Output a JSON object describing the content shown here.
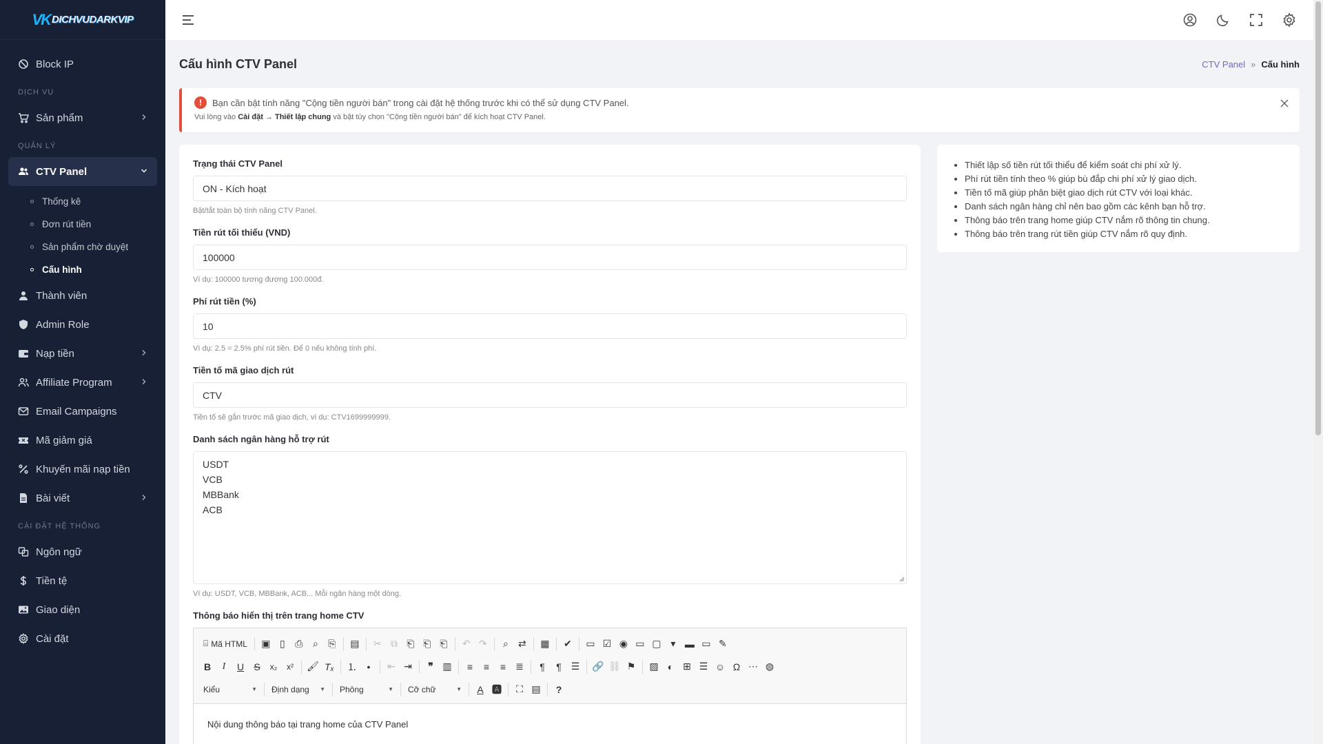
{
  "brand": {
    "logo_mark": "VK",
    "logo_text": "DICHVUDARKVIP"
  },
  "sidebar": {
    "block_ip": "Block IP",
    "section_service": "DỊCH VỤ",
    "products": "Sản phẩm",
    "section_manage": "QUẢN LÝ",
    "ctv_panel": "CTV Panel",
    "ctv_sub": [
      "Thống kê",
      "Đơn rút tiền",
      "Sản phẩm chờ duyệt",
      "Cấu hình"
    ],
    "members": "Thành viên",
    "admin_role": "Admin Role",
    "topup": "Nạp tiền",
    "affiliate": "Affiliate Program",
    "email_campaigns": "Email Campaigns",
    "coupons": "Mã giảm giá",
    "topup_promo": "Khuyến mãi nạp tiền",
    "posts": "Bài viết",
    "section_system": "CÀI ĐẶT HỆ THỐNG",
    "language": "Ngôn ngữ",
    "currency": "Tiền tệ",
    "theme": "Giao diện",
    "settings": "Cài đặt"
  },
  "header": {
    "icons": [
      "menu-icon",
      "user-circle-icon",
      "moon-icon",
      "fullscreen-icon",
      "gear-icon"
    ]
  },
  "page": {
    "title": "Cấu hình CTV Panel",
    "breadcrumb_parent": "CTV Panel",
    "breadcrumb_sep": "»",
    "breadcrumb_current": "Cấu hình"
  },
  "alert": {
    "message": "Bạn cần bật tính năng \"Cộng tiền người bán\" trong cài đặt hệ thống trước khi có thể sử dụng CTV Panel.",
    "detail_prefix": "Vui lòng vào ",
    "detail_path": "Cài đặt → Thiết lập chung",
    "detail_suffix": " và bật tùy chọn \"Cộng tiền người bán\" để kích hoạt CTV Panel."
  },
  "form": {
    "status_label": "Trạng thái CTV Panel",
    "status_value": "ON - Kích hoạt",
    "status_hint": "Bật/tắt toàn bộ tính năng CTV Panel.",
    "min_label": "Tiền rút tối thiểu (VND)",
    "min_value": "100000",
    "min_hint": "Ví dụ: 100000 tương đương 100.000đ.",
    "fee_label": "Phí rút tiền (%)",
    "fee_value": "10",
    "fee_hint": "Ví dụ: 2.5 = 2.5% phí rút tiền. Để 0 nếu không tính phí.",
    "prefix_label": "Tiền tố mã giao dịch rút",
    "prefix_value": "CTV",
    "prefix_hint": "Tiền tố sẽ gắn trước mã giao dịch, ví dụ: CTV1699999999.",
    "banks_label": "Danh sách ngân hàng hỗ trợ rút",
    "banks": [
      "USDT",
      "VCB",
      "MBBank",
      "ACB"
    ],
    "banks_hint": "Ví dụ: USDT, VCB, MBBank, ACB... Mỗi ngân hàng một dòng.",
    "notice_label": "Thông báo hiển thị trên trang home CTV"
  },
  "editor": {
    "source_label": "Mã HTML",
    "combo_style": "Kiểu",
    "combo_format": "Định dạng",
    "combo_font": "Phông",
    "combo_size": "Cỡ chữ",
    "body": "Nội dung thông báo tại trang home của CTV Panel"
  },
  "tips": [
    "Thiết lập số tiền rút tối thiểu để kiểm soát chi phí xử lý.",
    "Phí rút tiền tính theo % giúp bù đắp chi phí xử lý giao dịch.",
    "Tiền tố mã giúp phân biệt giao dịch rút CTV với loại khác.",
    "Danh sách ngân hàng chỉ nên bao gồm các kênh bạn hỗ trợ.",
    "Thông báo trên trang home giúp CTV nắm rõ thông tin chung.",
    "Thông báo trên trang rút tiền giúp CTV nắm rõ quy định."
  ],
  "colors": {
    "sidebar_bg": "#182035",
    "accent": "#6f67c9",
    "danger": "#e44d3a"
  }
}
